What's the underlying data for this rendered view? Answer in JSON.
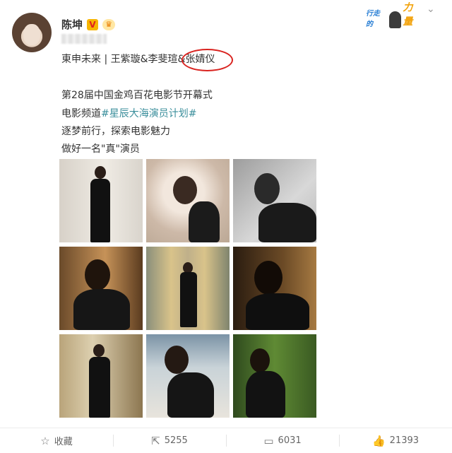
{
  "author": {
    "name": "陈坤",
    "vip_badge": "V",
    "crown_badge": "♛"
  },
  "campaign": {
    "small": "行走的",
    "big": "力量"
  },
  "top_chevron": "⌄",
  "tags_line": "東申未来 | 王紫璇&李斐瑄&张婧仪",
  "lines": {
    "l1": "第28届中国金鸡百花电影节开幕式",
    "l2_prefix": "电影频道",
    "l2_hashtag": "#星辰大海演员计划#",
    "l3": "逐梦前行，探索电影魅力",
    "l4": "做好一名\"真\"演员"
  },
  "actions": {
    "collect": {
      "icon": "☆",
      "label": "收藏"
    },
    "repost": {
      "icon": "⇱",
      "count": "5255"
    },
    "comment": {
      "icon": "▭",
      "count": "6031"
    },
    "like": {
      "icon": "👍",
      "count": "21393"
    }
  }
}
